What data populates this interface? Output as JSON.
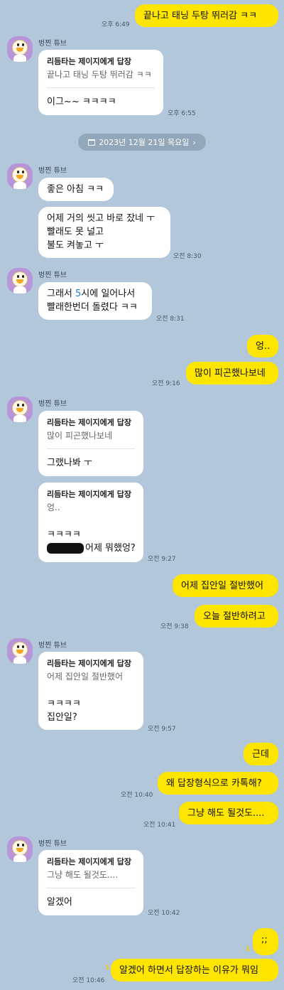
{
  "messages": {
    "m1": {
      "text": "끝나고 태닝 두탕 뛰러감 ㅋㅋ",
      "time": "오후 6:49"
    },
    "sender_name": "벙찐 튜브",
    "r1": {
      "head": "리듬타는 제이지에게 답장",
      "quote": "끝나고 태닝 두탕 뛰러감 ㅋㅋ",
      "text": "이그~~ ㅋㅋㅋㅋ",
      "time": "오후 6:55"
    },
    "date_divider": "2023년 12월 21일 목요일",
    "t1": {
      "text": "좋은 아침 ㅋㅋ"
    },
    "t2": {
      "line1": "어제 거의 씻고 바로 잤네 ㅜ",
      "line2": "빨래도 못 널고",
      "line3": "불도 켜놓고 ㅜ",
      "time": "오전 8:30"
    },
    "t3": {
      "line1_pre": "그래서 ",
      "line1_num": "5",
      "line1_post": "시에 일어나서",
      "line2": "빨래한번더 돌렸다 ㅋㅋ",
      "time": "오전 8:31"
    },
    "m2": {
      "text": "엉.."
    },
    "m3": {
      "text": "많이 피곤했나보네",
      "time": "오전 9:16"
    },
    "r2": {
      "head": "리듬타는 제이지에게 답장",
      "quote": "많이 피곤했나보네",
      "text": "그랬나봐 ㅜ"
    },
    "r3": {
      "head": "리듬타는 제이지에게 답장",
      "quote": "엉..",
      "text1": "ㅋㅋㅋㅋ",
      "text2": "어제 뭐했엉?",
      "time": "오전 9:27"
    },
    "m4": {
      "text": "어제 집안일 절반했어"
    },
    "m5": {
      "text": "오늘 절반하려고",
      "time": "오전 9:38"
    },
    "r4": {
      "head": "리듬타는 제이지에게 답장",
      "quote": "어제 집안일 절반했어",
      "text1": "ㅋㅋㅋㅋ",
      "text2": "집안일?",
      "time": "오전 9:57"
    },
    "m6": {
      "text": "근데"
    },
    "m7": {
      "text": "왜 답장형식으로 카톡해?",
      "time": "오전 10:40"
    },
    "m8": {
      "text": "그냥 해도 될것도....",
      "time": "오전 10:41"
    },
    "r5": {
      "head": "리듬타는 제이지에게 답장",
      "quote": "그냥 해도 될것도....",
      "text": "알겠어",
      "time": "오전 10:42"
    },
    "m9": {
      "text": ";;",
      "unread": "1"
    },
    "m10": {
      "text": "알겠어 하면서 답장하는 이유가 뭐임",
      "unread": "1",
      "time": "오전 10:46"
    }
  }
}
